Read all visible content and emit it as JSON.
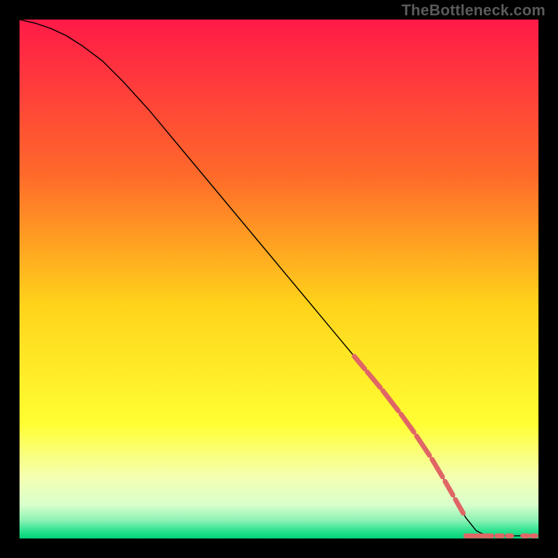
{
  "watermark": "TheBottleneck.com",
  "chart_data": {
    "type": "line",
    "title": "",
    "xlabel": "",
    "ylabel": "",
    "xlim": [
      0,
      100
    ],
    "ylim": [
      0,
      100
    ],
    "grid": false,
    "legend": false,
    "gradient_stops": [
      {
        "offset": 0.0,
        "color": "#ff1a48"
      },
      {
        "offset": 0.3,
        "color": "#ff6a2a"
      },
      {
        "offset": 0.55,
        "color": "#ffd31a"
      },
      {
        "offset": 0.78,
        "color": "#ffff33"
      },
      {
        "offset": 0.88,
        "color": "#f5ffb0"
      },
      {
        "offset": 0.935,
        "color": "#d9ffcc"
      },
      {
        "offset": 0.965,
        "color": "#8cf2b4"
      },
      {
        "offset": 0.985,
        "color": "#2de38f"
      },
      {
        "offset": 1.0,
        "color": "#00d47a"
      }
    ],
    "series": [
      {
        "name": "curve",
        "color": "#000000",
        "width": 1.5,
        "x": [
          0,
          3,
          6,
          9,
          12,
          16,
          20,
          25,
          30,
          35,
          40,
          45,
          50,
          55,
          60,
          65,
          70,
          75,
          80,
          82,
          84,
          86,
          88,
          90,
          92,
          94,
          96,
          98,
          100
        ],
        "y": [
          100,
          99.3,
          98.3,
          96.9,
          95.0,
          92.0,
          88.0,
          82.5,
          76.5,
          70.5,
          64.5,
          58.5,
          52.5,
          46.5,
          40.5,
          34.5,
          28.5,
          22.0,
          14.5,
          11.0,
          7.5,
          4.0,
          1.5,
          0.5,
          0.5,
          0.5,
          0.5,
          0.5,
          0.5
        ]
      }
    ],
    "dashes": {
      "color": "#e06666",
      "y_tail": 0.5,
      "segments_diag": [
        {
          "x0": 64.5,
          "x1": 66.5
        },
        {
          "x0": 67.0,
          "x1": 69.5
        },
        {
          "x0": 70.0,
          "x1": 73.0
        },
        {
          "x0": 73.5,
          "x1": 76.0
        },
        {
          "x0": 76.5,
          "x1": 79.0
        },
        {
          "x0": 79.5,
          "x1": 81.5
        },
        {
          "x0": 82.0,
          "x1": 83.5
        },
        {
          "x0": 84.0,
          "x1": 85.5
        }
      ],
      "segments_flat": [
        {
          "x0": 86.0,
          "x1": 87.5
        },
        {
          "x0": 88.0,
          "x1": 89.0
        },
        {
          "x0": 89.5,
          "x1": 91.0
        },
        {
          "x0": 92.0,
          "x1": 93.0
        },
        {
          "x0": 94.0,
          "x1": 94.8
        },
        {
          "x0": 97.0,
          "x1": 98.0
        },
        {
          "x0": 98.8,
          "x1": 99.5
        }
      ]
    }
  }
}
